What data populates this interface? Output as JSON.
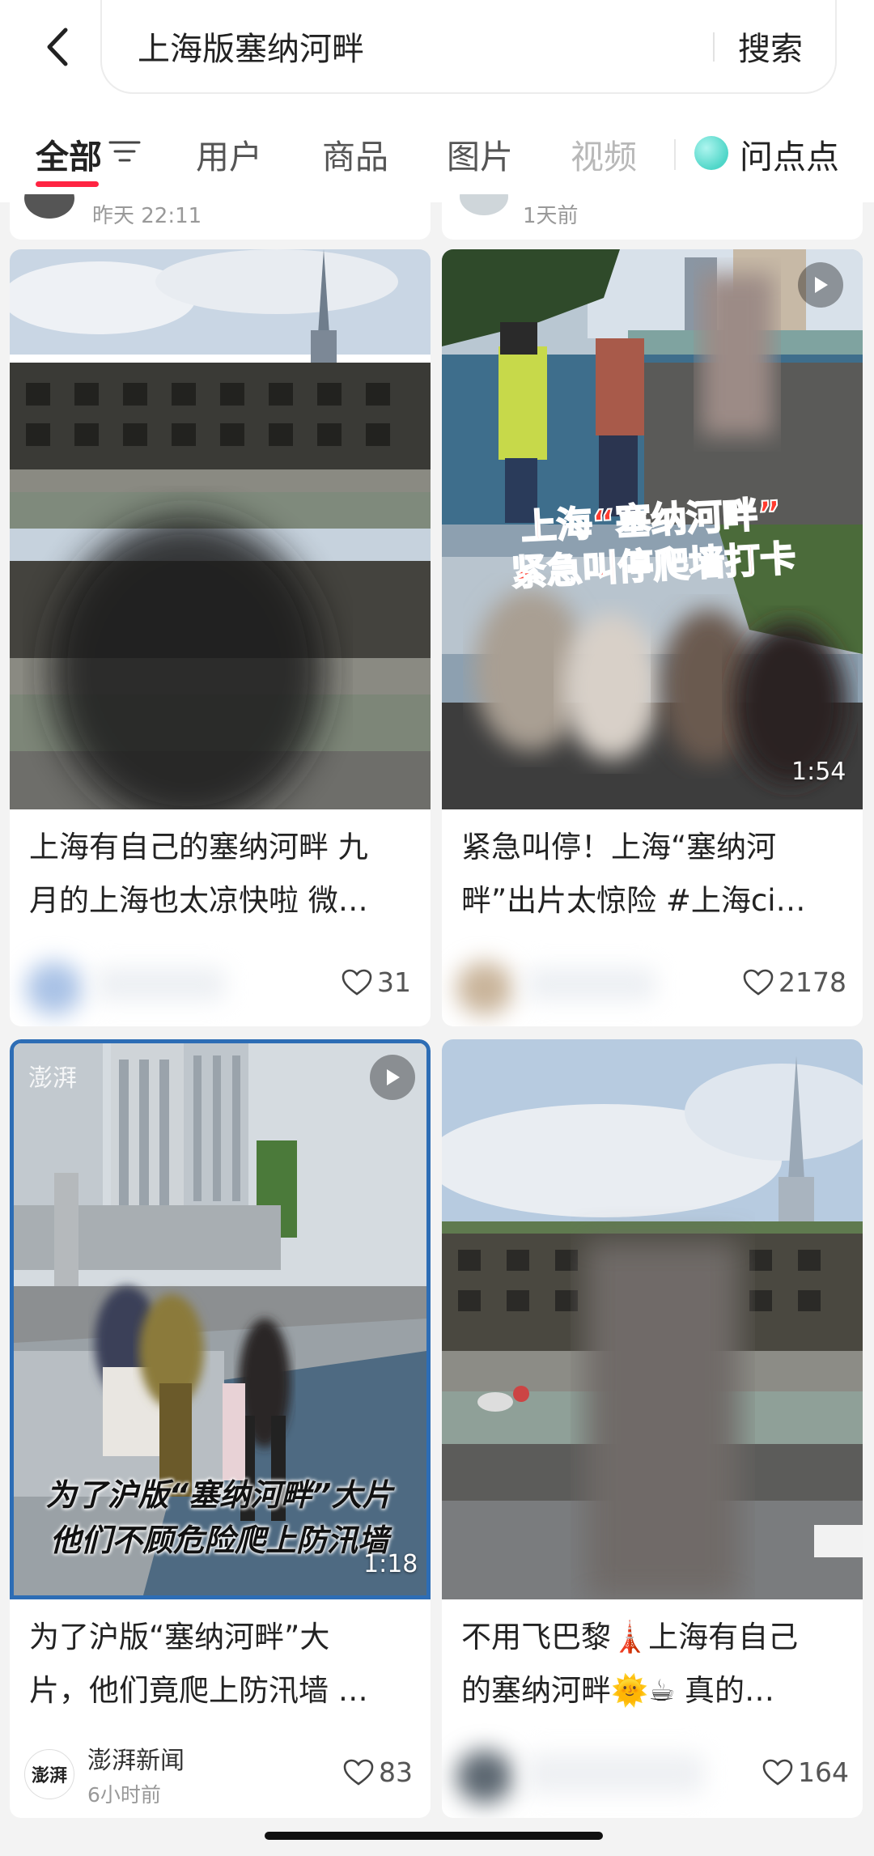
{
  "search": {
    "query": "上海版塞纳河畔",
    "button_label": "搜索"
  },
  "tabs": [
    {
      "label": "全部",
      "state": "active"
    },
    {
      "label": "用户",
      "state": "normal"
    },
    {
      "label": "商品",
      "state": "normal"
    },
    {
      "label": "图片",
      "state": "normal"
    },
    {
      "label": "视频",
      "state": "dim"
    }
  ],
  "ai_tab": {
    "label": "问点点"
  },
  "top_partial": {
    "left_time": "昨天 22:11",
    "right_time": "1天前"
  },
  "cards": [
    {
      "title_line1": "上海有自己的塞纳河畔 九",
      "title_line2": "月的上海也太凉快啦 微…",
      "likes": "31"
    },
    {
      "overlay_line1": "上海“塞纳河畔”",
      "overlay_line2": "紧急叫停爬墙打卡",
      "duration": "1:54",
      "title_line1": "紧急叫停！上海“塞纳河",
      "title_line2": "畔”出片太惊险 #上海ci…",
      "likes": "2178"
    },
    {
      "overlay_line1": "为了沪版“塞纳河畔”大片",
      "overlay_line2": "他们不顾危险爬上防汛墙",
      "duration": "1:18",
      "title_line1": "为了沪版“塞纳河畔”大",
      "title_line2": "片，他们竟爬上防汛墙 …",
      "author_name": "澎湃新闻",
      "author_logo": "澎湃",
      "time": "6小时前",
      "likes": "83"
    },
    {
      "title_line1": "不用飞巴黎🗼上海有自己",
      "title_line2": "的塞纳河畔🌞☕ 真的…",
      "likes": "164"
    }
  ],
  "colors": {
    "accent": "#ff2442",
    "overlay_red": "#ff3b2f",
    "frame_blue": "#2d6db5"
  }
}
